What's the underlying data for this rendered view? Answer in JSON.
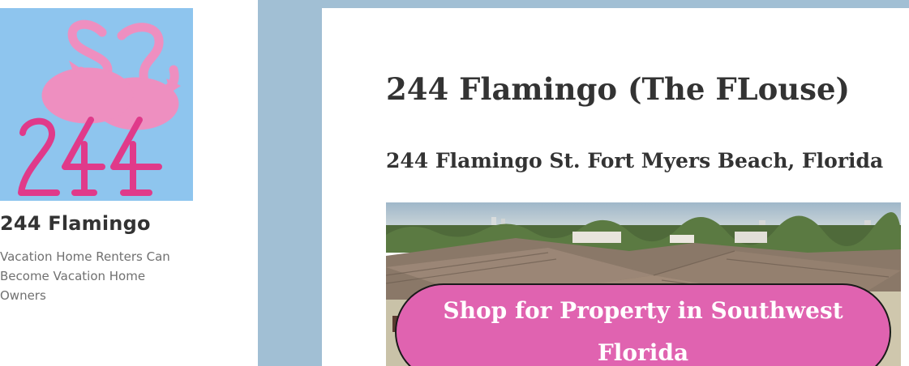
{
  "sidebar": {
    "logo_text": "244",
    "site_title": "244 Flamingo",
    "site_description": "Vacation Home Renters Can Become Vacation Home Owners"
  },
  "main": {
    "page_title": "244 Flamingo (The FLouse)",
    "page_subtitle": "244 Flamingo St. Fort Myers Beach, Florida",
    "cta_label": "Shop for Property in Southwest Florida"
  },
  "colors": {
    "logo_bg": "#8ec5ee",
    "flamingo_pink": "#ee8fc0",
    "logo_number": "#e03a8a",
    "main_bg": "#a1bfd4",
    "cta_bg": "#e063b0"
  }
}
